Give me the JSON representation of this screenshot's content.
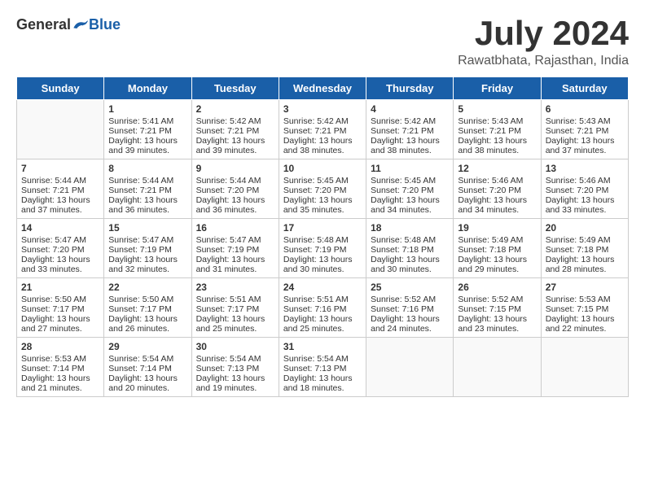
{
  "header": {
    "logo_general": "General",
    "logo_blue": "Blue",
    "month": "July 2024",
    "location": "Rawatbhata, Rajasthan, India"
  },
  "weekdays": [
    "Sunday",
    "Monday",
    "Tuesday",
    "Wednesday",
    "Thursday",
    "Friday",
    "Saturday"
  ],
  "weeks": [
    [
      {
        "day": "",
        "sunrise": "",
        "sunset": "",
        "daylight": "",
        "empty": true
      },
      {
        "day": "1",
        "sunrise": "Sunrise: 5:41 AM",
        "sunset": "Sunset: 7:21 PM",
        "daylight": "Daylight: 13 hours and 39 minutes."
      },
      {
        "day": "2",
        "sunrise": "Sunrise: 5:42 AM",
        "sunset": "Sunset: 7:21 PM",
        "daylight": "Daylight: 13 hours and 39 minutes."
      },
      {
        "day": "3",
        "sunrise": "Sunrise: 5:42 AM",
        "sunset": "Sunset: 7:21 PM",
        "daylight": "Daylight: 13 hours and 38 minutes."
      },
      {
        "day": "4",
        "sunrise": "Sunrise: 5:42 AM",
        "sunset": "Sunset: 7:21 PM",
        "daylight": "Daylight: 13 hours and 38 minutes."
      },
      {
        "day": "5",
        "sunrise": "Sunrise: 5:43 AM",
        "sunset": "Sunset: 7:21 PM",
        "daylight": "Daylight: 13 hours and 38 minutes."
      },
      {
        "day": "6",
        "sunrise": "Sunrise: 5:43 AM",
        "sunset": "Sunset: 7:21 PM",
        "daylight": "Daylight: 13 hours and 37 minutes."
      }
    ],
    [
      {
        "day": "7",
        "sunrise": "Sunrise: 5:44 AM",
        "sunset": "Sunset: 7:21 PM",
        "daylight": "Daylight: 13 hours and 37 minutes."
      },
      {
        "day": "8",
        "sunrise": "Sunrise: 5:44 AM",
        "sunset": "Sunset: 7:21 PM",
        "daylight": "Daylight: 13 hours and 36 minutes."
      },
      {
        "day": "9",
        "sunrise": "Sunrise: 5:44 AM",
        "sunset": "Sunset: 7:20 PM",
        "daylight": "Daylight: 13 hours and 36 minutes."
      },
      {
        "day": "10",
        "sunrise": "Sunrise: 5:45 AM",
        "sunset": "Sunset: 7:20 PM",
        "daylight": "Daylight: 13 hours and 35 minutes."
      },
      {
        "day": "11",
        "sunrise": "Sunrise: 5:45 AM",
        "sunset": "Sunset: 7:20 PM",
        "daylight": "Daylight: 13 hours and 34 minutes."
      },
      {
        "day": "12",
        "sunrise": "Sunrise: 5:46 AM",
        "sunset": "Sunset: 7:20 PM",
        "daylight": "Daylight: 13 hours and 34 minutes."
      },
      {
        "day": "13",
        "sunrise": "Sunrise: 5:46 AM",
        "sunset": "Sunset: 7:20 PM",
        "daylight": "Daylight: 13 hours and 33 minutes."
      }
    ],
    [
      {
        "day": "14",
        "sunrise": "Sunrise: 5:47 AM",
        "sunset": "Sunset: 7:20 PM",
        "daylight": "Daylight: 13 hours and 33 minutes."
      },
      {
        "day": "15",
        "sunrise": "Sunrise: 5:47 AM",
        "sunset": "Sunset: 7:19 PM",
        "daylight": "Daylight: 13 hours and 32 minutes."
      },
      {
        "day": "16",
        "sunrise": "Sunrise: 5:47 AM",
        "sunset": "Sunset: 7:19 PM",
        "daylight": "Daylight: 13 hours and 31 minutes."
      },
      {
        "day": "17",
        "sunrise": "Sunrise: 5:48 AM",
        "sunset": "Sunset: 7:19 PM",
        "daylight": "Daylight: 13 hours and 30 minutes."
      },
      {
        "day": "18",
        "sunrise": "Sunrise: 5:48 AM",
        "sunset": "Sunset: 7:18 PM",
        "daylight": "Daylight: 13 hours and 30 minutes."
      },
      {
        "day": "19",
        "sunrise": "Sunrise: 5:49 AM",
        "sunset": "Sunset: 7:18 PM",
        "daylight": "Daylight: 13 hours and 29 minutes."
      },
      {
        "day": "20",
        "sunrise": "Sunrise: 5:49 AM",
        "sunset": "Sunset: 7:18 PM",
        "daylight": "Daylight: 13 hours and 28 minutes."
      }
    ],
    [
      {
        "day": "21",
        "sunrise": "Sunrise: 5:50 AM",
        "sunset": "Sunset: 7:17 PM",
        "daylight": "Daylight: 13 hours and 27 minutes."
      },
      {
        "day": "22",
        "sunrise": "Sunrise: 5:50 AM",
        "sunset": "Sunset: 7:17 PM",
        "daylight": "Daylight: 13 hours and 26 minutes."
      },
      {
        "day": "23",
        "sunrise": "Sunrise: 5:51 AM",
        "sunset": "Sunset: 7:17 PM",
        "daylight": "Daylight: 13 hours and 25 minutes."
      },
      {
        "day": "24",
        "sunrise": "Sunrise: 5:51 AM",
        "sunset": "Sunset: 7:16 PM",
        "daylight": "Daylight: 13 hours and 25 minutes."
      },
      {
        "day": "25",
        "sunrise": "Sunrise: 5:52 AM",
        "sunset": "Sunset: 7:16 PM",
        "daylight": "Daylight: 13 hours and 24 minutes."
      },
      {
        "day": "26",
        "sunrise": "Sunrise: 5:52 AM",
        "sunset": "Sunset: 7:15 PM",
        "daylight": "Daylight: 13 hours and 23 minutes."
      },
      {
        "day": "27",
        "sunrise": "Sunrise: 5:53 AM",
        "sunset": "Sunset: 7:15 PM",
        "daylight": "Daylight: 13 hours and 22 minutes."
      }
    ],
    [
      {
        "day": "28",
        "sunrise": "Sunrise: 5:53 AM",
        "sunset": "Sunset: 7:14 PM",
        "daylight": "Daylight: 13 hours and 21 minutes."
      },
      {
        "day": "29",
        "sunrise": "Sunrise: 5:54 AM",
        "sunset": "Sunset: 7:14 PM",
        "daylight": "Daylight: 13 hours and 20 minutes."
      },
      {
        "day": "30",
        "sunrise": "Sunrise: 5:54 AM",
        "sunset": "Sunset: 7:13 PM",
        "daylight": "Daylight: 13 hours and 19 minutes."
      },
      {
        "day": "31",
        "sunrise": "Sunrise: 5:54 AM",
        "sunset": "Sunset: 7:13 PM",
        "daylight": "Daylight: 13 hours and 18 minutes."
      },
      {
        "day": "",
        "sunrise": "",
        "sunset": "",
        "daylight": "",
        "empty": true
      },
      {
        "day": "",
        "sunrise": "",
        "sunset": "",
        "daylight": "",
        "empty": true
      },
      {
        "day": "",
        "sunrise": "",
        "sunset": "",
        "daylight": "",
        "empty": true
      }
    ]
  ]
}
